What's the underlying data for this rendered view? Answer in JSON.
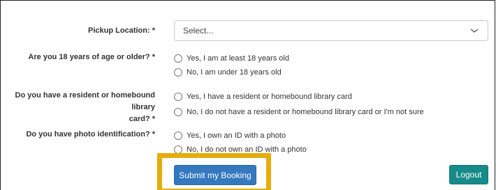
{
  "pickup": {
    "label": "Pickup Location: *",
    "value": "Select..."
  },
  "age": {
    "label": "Are you 18 years of age or older? *",
    "options": [
      "Yes, I am at least 18 years old",
      "No, I am under 18 years old"
    ]
  },
  "library_card": {
    "label_line1": "Do you have a resident or homebound library",
    "label_line2": "card? *",
    "options": [
      "Yes, I have a resident or homebound library card",
      "No, I do not have a resident or homebound library card or I'm not sure"
    ]
  },
  "photo_id": {
    "label": "Do you have photo identification? *",
    "options": [
      "Yes, I own an ID with a photo",
      "No, I do not own an ID with a photo"
    ]
  },
  "actions": {
    "submit_label": "Submit my Booking",
    "logout_label": "Logout"
  },
  "colors": {
    "highlight": "#e6ac0b",
    "submit": "#3478c0",
    "logout": "#178a8a"
  }
}
